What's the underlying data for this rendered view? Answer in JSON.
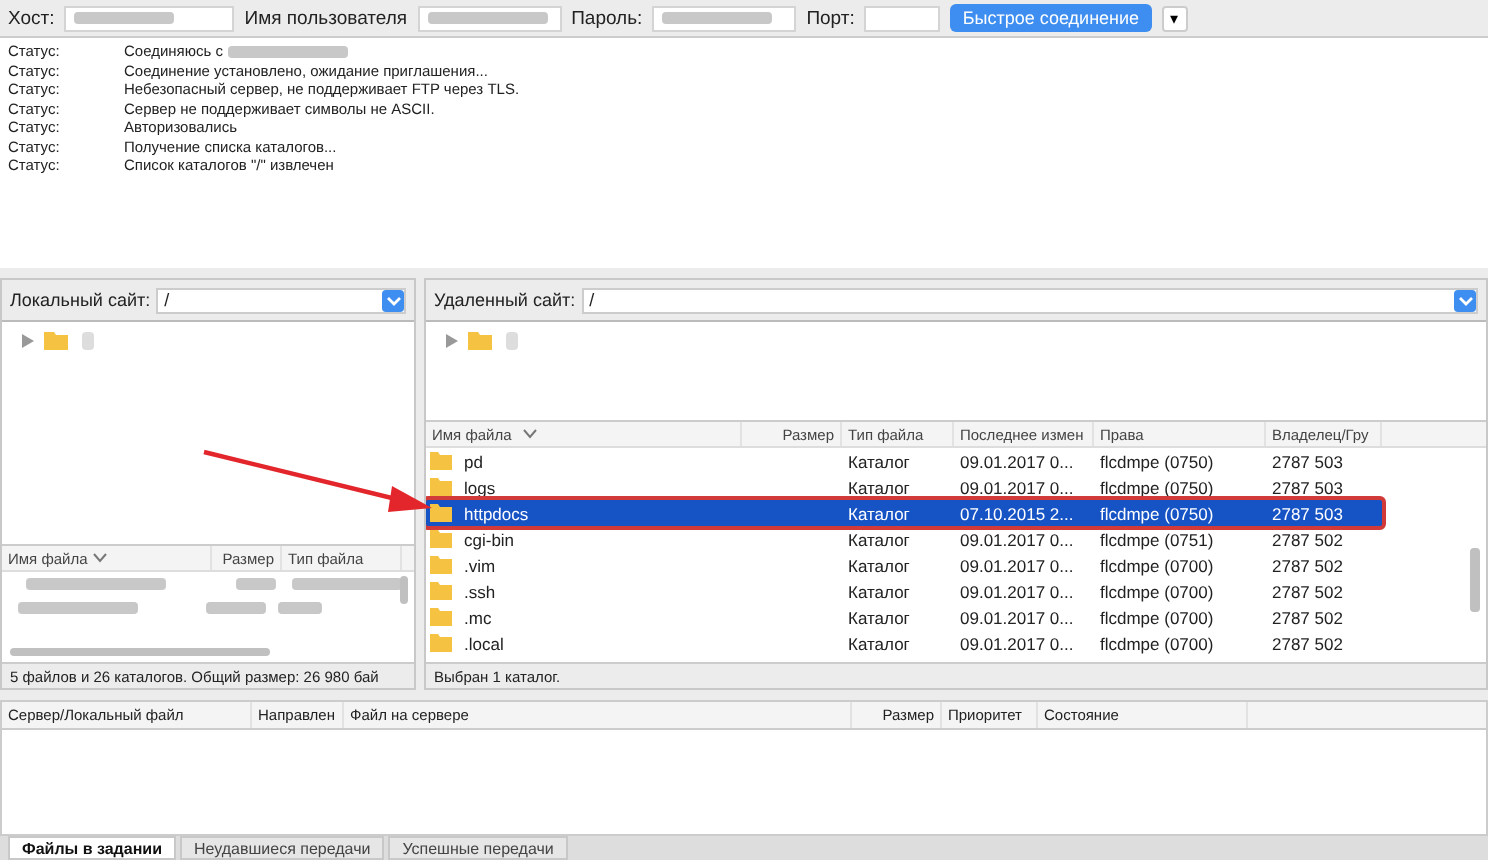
{
  "toolbar": {
    "host_label": "Хост:",
    "user_label": "Имя пользователя",
    "password_label": "Пароль:",
    "port_label": "Порт:",
    "connect_button": "Быстрое соединение",
    "dropdown_glyph": "▾"
  },
  "log": [
    {
      "label": "Статус:",
      "message": "Соединяюсь с",
      "redacted": true
    },
    {
      "label": "Статус:",
      "message": "Соединение установлено, ожидание приглашения...",
      "redacted": false
    },
    {
      "label": "Статус:",
      "message": "Небезопасный сервер, не поддерживает FTP через TLS.",
      "redacted": false
    },
    {
      "label": "Статус:",
      "message": "Сервер не поддерживает символы не ASCII.",
      "redacted": false
    },
    {
      "label": "Статус:",
      "message": "Авторизовались",
      "redacted": false
    },
    {
      "label": "Статус:",
      "message": "Получение списка каталогов...",
      "redacted": false
    },
    {
      "label": "Статус:",
      "message": "Список каталогов \"/\" извлечен",
      "redacted": false
    }
  ],
  "local": {
    "site_label": "Локальный сайт:",
    "path": "/",
    "columns": [
      "Имя файла",
      "Размер",
      "Тип файла"
    ],
    "status": "5 файлов и 26 каталогов. Общий размер: 26 980 бай"
  },
  "remote": {
    "site_label": "Удаленный сайт:",
    "path": "/",
    "columns": [
      "Имя файла",
      "Размер",
      "Тип файла",
      "Последнее измен",
      "Права",
      "Владелец/Гру"
    ],
    "rows": [
      {
        "name": "pd",
        "type": "Каталог",
        "modified": "09.01.2017 0...",
        "rights": "flcdmpe (0750)",
        "owner": "2787 503",
        "selected": false
      },
      {
        "name": "logs",
        "type": "Каталог",
        "modified": "09.01.2017 0...",
        "rights": "flcdmpe (0750)",
        "owner": "2787 503",
        "selected": false
      },
      {
        "name": "httpdocs",
        "type": "Каталог",
        "modified": "07.10.2015 2...",
        "rights": "flcdmpe (0750)",
        "owner": "2787 503",
        "selected": true
      },
      {
        "name": "cgi-bin",
        "type": "Каталог",
        "modified": "09.01.2017 0...",
        "rights": "flcdmpe (0751)",
        "owner": "2787 502",
        "selected": false
      },
      {
        "name": ".vim",
        "type": "Каталог",
        "modified": "09.01.2017 0...",
        "rights": "flcdmpe (0700)",
        "owner": "2787 502",
        "selected": false
      },
      {
        "name": ".ssh",
        "type": "Каталог",
        "modified": "09.01.2017 0...",
        "rights": "flcdmpe (0700)",
        "owner": "2787 502",
        "selected": false
      },
      {
        "name": ".mc",
        "type": "Каталог",
        "modified": "09.01.2017 0...",
        "rights": "flcdmpe (0700)",
        "owner": "2787 502",
        "selected": false
      },
      {
        "name": ".local",
        "type": "Каталог",
        "modified": "09.01.2017 0...",
        "rights": "flcdmpe (0700)",
        "owner": "2787 502",
        "selected": false
      }
    ],
    "status": "Выбран 1 каталог."
  },
  "queue": {
    "columns": [
      "Сервер/Локальный файл",
      "Направлен",
      "Файл на сервере",
      "Размер",
      "Приоритет",
      "Состояние"
    ]
  },
  "tabs": [
    {
      "label": "Файлы в задании",
      "selected": true
    },
    {
      "label": "Неудавшиеся передачи",
      "selected": false
    },
    {
      "label": "Успешные передачи",
      "selected": false
    }
  ]
}
